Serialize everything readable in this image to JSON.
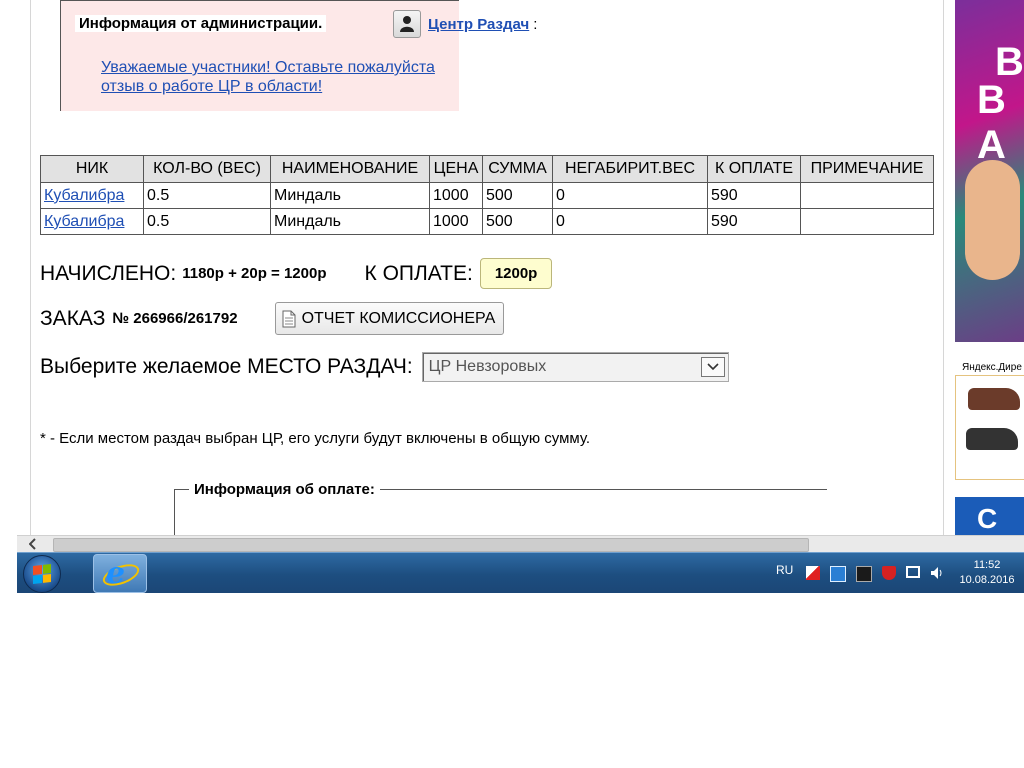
{
  "admin_info": {
    "legend": "Информация от администрации.",
    "author_link": "Центр Раздач",
    "author_suffix": ":",
    "message_link": "Уважаемые участники! Оставьте пожалуйста отзыв о работе ЦР в области!"
  },
  "orders_table": {
    "headers": [
      "НИК",
      "КОЛ-ВО (ВЕС)",
      "НАИМЕНОВАНИЕ",
      "ЦЕНА",
      "СУММА",
      "НЕГАБИРИТ.ВЕС",
      "К ОПЛАТЕ",
      "ПРИМЕЧАНИЕ"
    ],
    "rows": [
      [
        "Кубалибра",
        "0.5",
        "Миндаль",
        "1000",
        "500",
        "0",
        "590",
        ""
      ],
      [
        "Кубалибра",
        "0.5",
        "Миндаль",
        "1000",
        "500",
        "0",
        "590",
        ""
      ]
    ]
  },
  "summary": {
    "accrued_label": "НАЧИСЛЕНО:",
    "accrued_value": "1180р + 20р = 1200р",
    "to_pay_label": "К ОПЛАТЕ:",
    "to_pay_value": "1200р"
  },
  "order": {
    "label": "ЗАКАЗ",
    "number": "№ 266966/261792",
    "report_button": "ОТЧЕТ КОМИССИОНЕРА"
  },
  "pickup": {
    "label": "Выберите желаемое МЕСТО РАЗДАЧ:",
    "selected": "ЦР Невзоровых"
  },
  "footnote": "* - Если местом раздач выбран ЦР, его услуги будут включены в общую сумму.",
  "payment_info": {
    "legend": "Информация об оплате:"
  },
  "sidebar": {
    "banner_text_1": "В",
    "banner_text_2": "В А",
    "yandex_label": "Яндекс.Дире",
    "blue_ad_text": "С"
  },
  "taskbar": {
    "language": "RU",
    "time": "11:52",
    "date": "10.08.2016"
  }
}
